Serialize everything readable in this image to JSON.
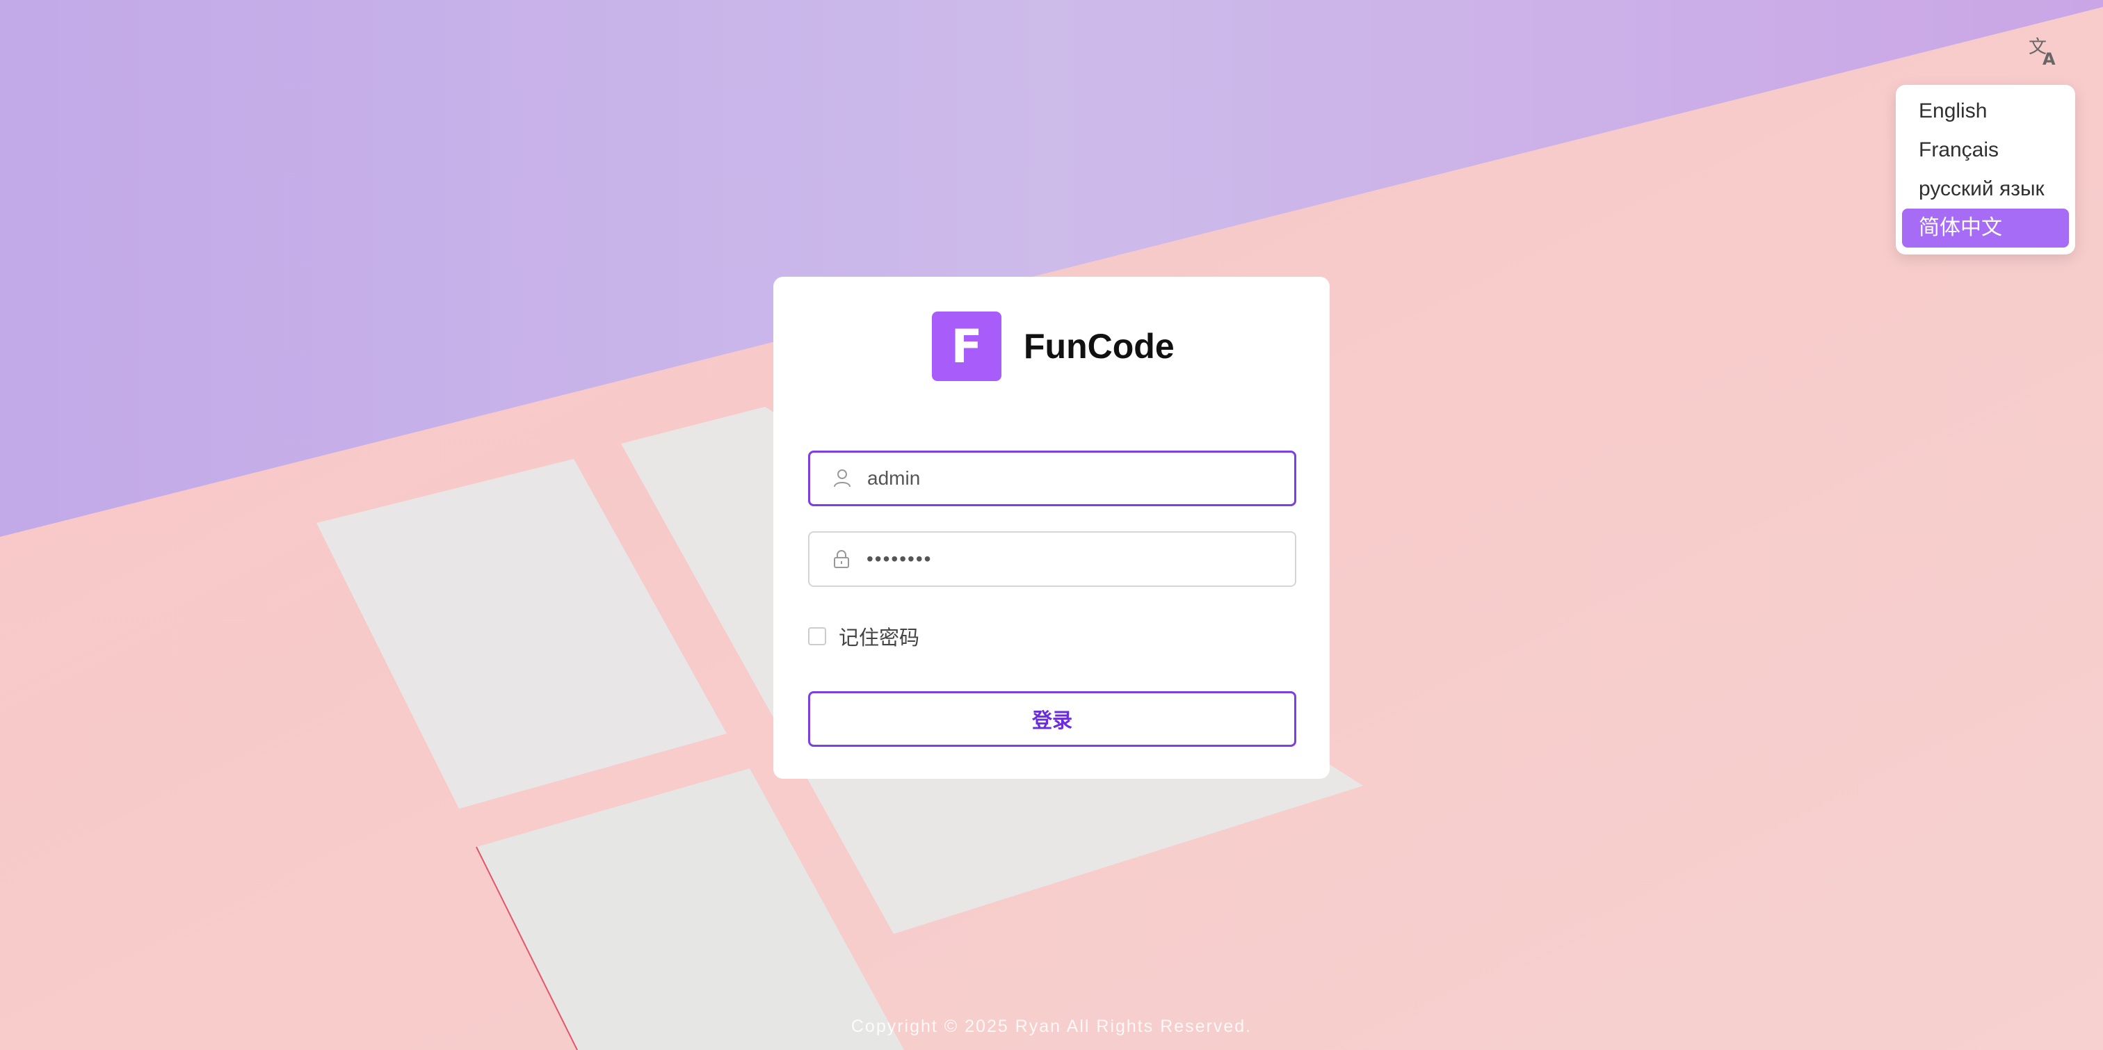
{
  "app": {
    "name": "FunCode",
    "logo_letter": "F"
  },
  "language_menu": {
    "items": [
      "English",
      "Français",
      "русский язык",
      "简体中文"
    ],
    "selected": "简体中文"
  },
  "login_form": {
    "username_value": "admin",
    "password_value": "••••••••",
    "remember_label": "记住密码",
    "remember_checked": false,
    "submit_label": "登录"
  },
  "footer": {
    "copyright": "Copyright © 2025 Ryan All Rights Reserved."
  },
  "colors": {
    "accent": "#a85cf9",
    "focus_border": "#7b3fe4",
    "menu_selected": "#a66cf5",
    "bg_purple": "#c8aef0",
    "bg_pink": "#f7c9c9"
  },
  "icons": {
    "translate": "translate-icon",
    "user": "user-icon",
    "lock": "lock-icon"
  }
}
